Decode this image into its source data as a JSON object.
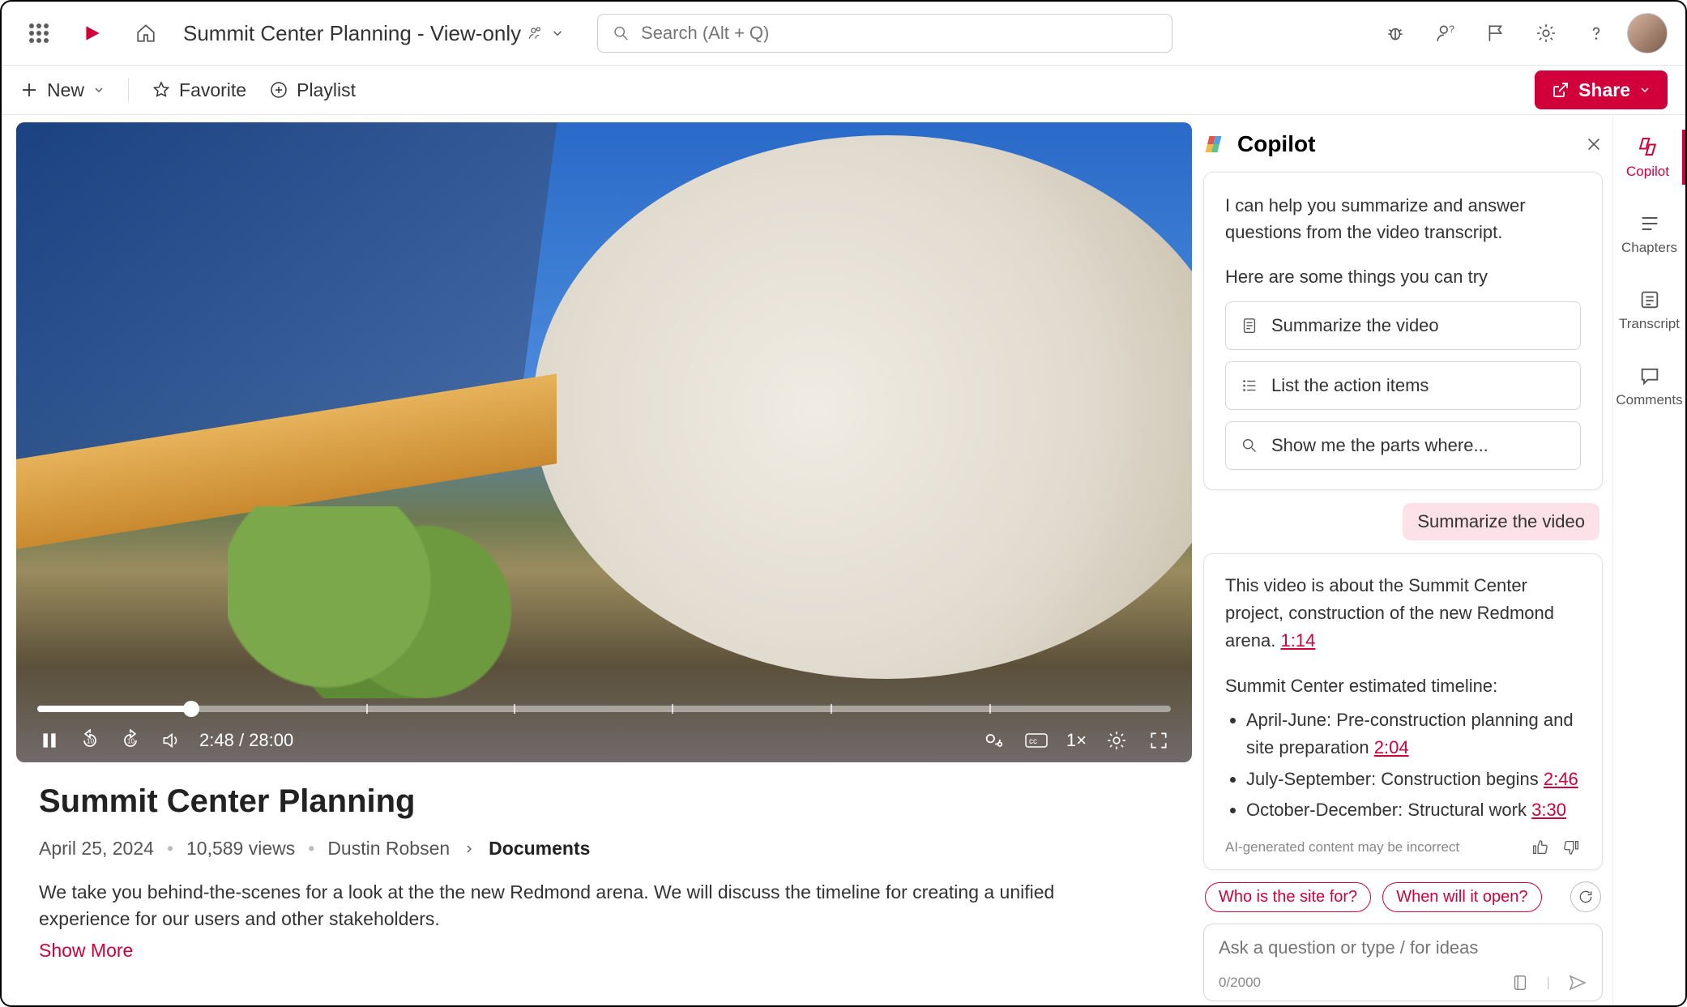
{
  "topbar": {
    "doc_title": "Summit Center Planning - View-only",
    "search_placeholder": "Search (Alt + Q)"
  },
  "cmdbar": {
    "new": "New",
    "favorite": "Favorite",
    "playlist": "Playlist",
    "share": "Share"
  },
  "player": {
    "time_current": "2:48",
    "time_total": "28:00",
    "speed": "1×"
  },
  "video": {
    "title": "Summit Center Planning",
    "date": "April 25, 2024",
    "views": "10,589 views",
    "author": "Dustin Robsen",
    "breadcrumb": "Documents",
    "description": "We take you behind-the-scenes for a look at the the new Redmond arena. We will discuss the timeline for creating a unified experience for our users and other stakeholders.",
    "show_more": "Show More"
  },
  "copilot": {
    "title": "Copilot",
    "intro": "I can help you summarize and answer questions from the video transcript.",
    "try_label": "Here are some things you can try",
    "suggestions": {
      "s1": "Summarize the video",
      "s2": "List the action items",
      "s3": "Show me the parts where..."
    },
    "user_msg": "Summarize the video",
    "answer_intro": "This video is about the Summit Center project, construction of the new Redmond arena.",
    "answer_ts1": "1:14",
    "timeline_header": "Summit Center estimated timeline:",
    "timeline": {
      "t1_text": "April-June: Pre-construction planning and site preparation",
      "t1_ts": "2:04",
      "t2_text": "July-September: Construction begins",
      "t2_ts": "2:46",
      "t3_text": "October-December: Structural work",
      "t3_ts": "3:30"
    },
    "disclaimer": "AI-generated content may be incorrect",
    "followups": {
      "f1": "Who is the site for?",
      "f2": "When will it open?"
    },
    "ask_placeholder": "Ask a question or type / for ideas",
    "char_count": "0/2000"
  },
  "rail": {
    "copilot": "Copilot",
    "chapters": "Chapters",
    "transcript": "Transcript",
    "comments": "Comments"
  }
}
